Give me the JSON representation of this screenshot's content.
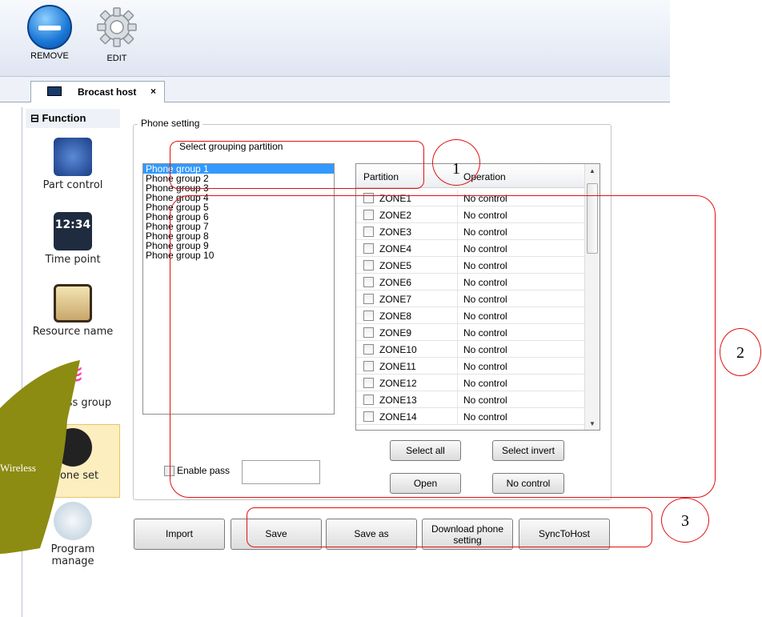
{
  "toolbar": {
    "remove_label": "REMOVE",
    "edit_label": "EDIT"
  },
  "tab": {
    "label": "Brocast host",
    "close": "×"
  },
  "function_panel": {
    "header": "Function",
    "items": [
      {
        "label": "Part control",
        "icon": "part-control-icon"
      },
      {
        "label": "Time point",
        "icon": "time-point-icon",
        "icon_text": "12:34"
      },
      {
        "label": "Resource name",
        "icon": "resource-name-icon"
      },
      {
        "label": "Wireless group",
        "icon": "wireless-group-icon"
      },
      {
        "label": "Phone set",
        "icon": "phone-set-icon",
        "selected": true
      },
      {
        "label": "Program manage",
        "icon": "program-manage-icon"
      }
    ]
  },
  "callout": {
    "text": "Wireless"
  },
  "phone_setting": {
    "title": "Phone setting",
    "grouping_label": "Select grouping partition",
    "groups": [
      "Phone group 1",
      "Phone group 2",
      "Phone group 3",
      "Phone group 4",
      "Phone group 5",
      "Phone group 6",
      "Phone group 7",
      "Phone group 8",
      "Phone group 9",
      "Phone group 10"
    ],
    "selected_group_index": 0,
    "table_headers": {
      "partition": "Partition",
      "operation": "Operation"
    },
    "zones": [
      {
        "name": "ZONE1",
        "operation": "No control"
      },
      {
        "name": "ZONE2",
        "operation": "No control"
      },
      {
        "name": "ZONE3",
        "operation": "No control"
      },
      {
        "name": "ZONE4",
        "operation": "No control"
      },
      {
        "name": "ZONE5",
        "operation": "No control"
      },
      {
        "name": "ZONE6",
        "operation": "No control"
      },
      {
        "name": "ZONE7",
        "operation": "No control"
      },
      {
        "name": "ZONE8",
        "operation": "No control"
      },
      {
        "name": "ZONE9",
        "operation": "No control"
      },
      {
        "name": "ZONE10",
        "operation": "No control"
      },
      {
        "name": "ZONE11",
        "operation": "No control"
      },
      {
        "name": "ZONE12",
        "operation": "No control"
      },
      {
        "name": "ZONE13",
        "operation": "No control"
      },
      {
        "name": "ZONE14",
        "operation": "No control"
      }
    ],
    "buttons": {
      "select_all": "Select all",
      "select_invert": "Select invert",
      "open": "Open",
      "no_control": "No control"
    },
    "enable_pass_label": "Enable pass",
    "pass_value": ""
  },
  "bottom_buttons": {
    "import": "Import",
    "save": "Save",
    "save_as": "Save as",
    "download_line1": "Download phone",
    "download_line2": "setting",
    "sync": "SyncToHost"
  },
  "annotations": [
    "1",
    "2",
    "3"
  ],
  "colors": {
    "selection": "#3399ff",
    "annotation_red": "#e01010",
    "callout_olive": "#8c8c12",
    "phone_set_highlight": "#fdeebf"
  }
}
